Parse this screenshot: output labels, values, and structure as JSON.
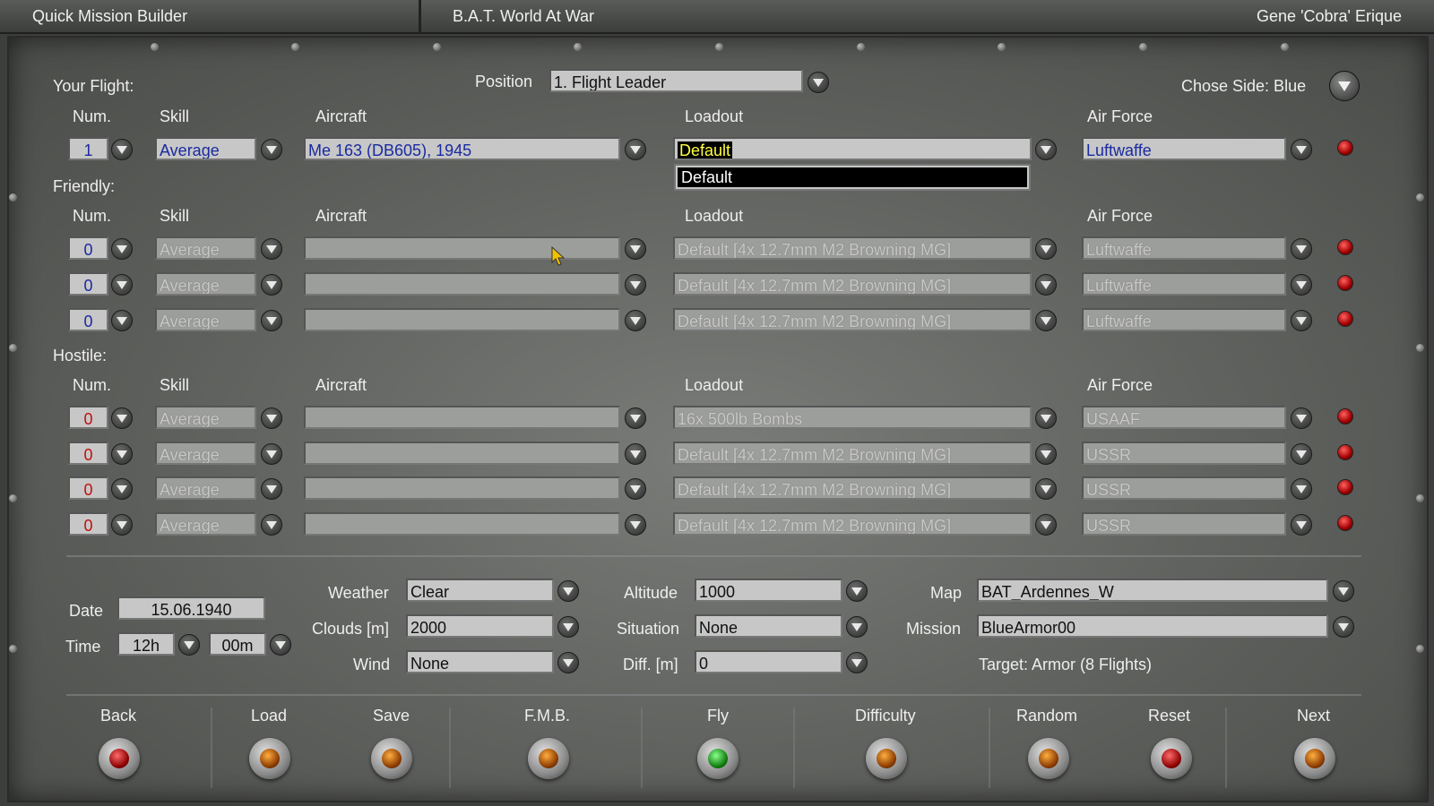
{
  "titlebar": {
    "left": "Quick Mission Builder",
    "center": "B.A.T. World At War",
    "right": "Gene 'Cobra' Erique"
  },
  "your_flight": {
    "label": "Your Flight:",
    "position_label": "Position",
    "position_value": "1. Flight Leader",
    "side_label": "Chose Side: Blue",
    "headers": {
      "num": "Num.",
      "skill": "Skill",
      "aircraft": "Aircraft",
      "loadout": "Loadout",
      "airforce": "Air Force"
    },
    "row": {
      "num": "1",
      "skill": "Average",
      "aircraft": "Me 163 (DB605), 1945",
      "loadout": "Default",
      "airforce": "Luftwaffe"
    },
    "loadout_options": [
      "Default"
    ]
  },
  "friendly": {
    "label": "Friendly:",
    "headers": {
      "num": "Num.",
      "skill": "Skill",
      "aircraft": "Aircraft",
      "loadout": "Loadout",
      "airforce": "Air Force"
    },
    "rows": [
      {
        "num": "0",
        "skill": "Average",
        "aircraft": "",
        "loadout": "Default [4x 12.7mm M2 Browning MG]",
        "airforce": "Luftwaffe"
      },
      {
        "num": "0",
        "skill": "Average",
        "aircraft": "",
        "loadout": "Default [4x 12.7mm M2 Browning MG]",
        "airforce": "Luftwaffe"
      },
      {
        "num": "0",
        "skill": "Average",
        "aircraft": "",
        "loadout": "Default [4x 12.7mm M2 Browning MG]",
        "airforce": "Luftwaffe"
      }
    ]
  },
  "hostile": {
    "label": "Hostile:",
    "headers": {
      "num": "Num.",
      "skill": "Skill",
      "aircraft": "Aircraft",
      "loadout": "Loadout",
      "airforce": "Air Force"
    },
    "rows": [
      {
        "num": "0",
        "skill": "Average",
        "aircraft": "",
        "loadout": "16x 500lb Bombs",
        "airforce": "USAAF"
      },
      {
        "num": "0",
        "skill": "Average",
        "aircraft": "",
        "loadout": "Default [4x 12.7mm M2 Browning MG]",
        "airforce": "USSR"
      },
      {
        "num": "0",
        "skill": "Average",
        "aircraft": "",
        "loadout": "Default [4x 12.7mm M2 Browning MG]",
        "airforce": "USSR"
      },
      {
        "num": "0",
        "skill": "Average",
        "aircraft": "",
        "loadout": "Default [4x 12.7mm M2 Browning MG]",
        "airforce": "USSR"
      }
    ]
  },
  "conditions": {
    "date_label": "Date",
    "date_value": "15.06.1940",
    "time_label": "Time",
    "time_hour": "12h",
    "time_min": "00m",
    "weather_label": "Weather",
    "weather_value": "Clear",
    "clouds_label": "Clouds [m]",
    "clouds_value": "2000",
    "wind_label": "Wind",
    "wind_value": "None",
    "altitude_label": "Altitude",
    "altitude_value": "1000",
    "situation_label": "Situation",
    "situation_value": "None",
    "diff_label": "Diff. [m]",
    "diff_value": "0",
    "map_label": "Map",
    "map_value": "BAT_Ardennes_W",
    "mission_label": "Mission",
    "mission_value": "BlueArmor00",
    "target_text": "Target: Armor (8 Flights)"
  },
  "buttons": [
    {
      "label": "Back",
      "led": "red"
    },
    {
      "label": "Load",
      "led": "amber"
    },
    {
      "label": "Save",
      "led": "amber"
    },
    {
      "label": "F.M.B.",
      "led": "amber"
    },
    {
      "label": "Fly",
      "led": "green"
    },
    {
      "label": "Difficulty",
      "led": "amber"
    },
    {
      "label": "Random",
      "led": "amber"
    },
    {
      "label": "Reset",
      "led": "red"
    },
    {
      "label": "Next",
      "led": "amber"
    }
  ]
}
